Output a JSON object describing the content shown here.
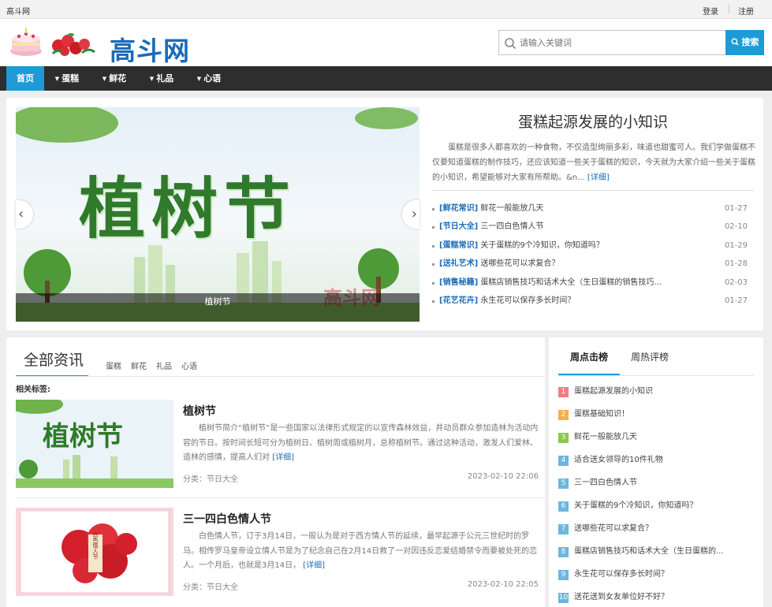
{
  "topbar": {
    "site_name": "高斗网",
    "login": "登录",
    "register": "注册"
  },
  "header": {
    "logo_text": "高斗网",
    "search_placeholder": "请输入关键词",
    "search_button": "搜索"
  },
  "nav": {
    "items": [
      {
        "label": "首页",
        "active": true
      },
      {
        "label": "蛋糕"
      },
      {
        "label": "鲜花"
      },
      {
        "label": "礼品"
      },
      {
        "label": "心语"
      }
    ]
  },
  "slider": {
    "title": "植树节",
    "caption": "植树节",
    "watermark": "高斗网"
  },
  "feature": {
    "title": "蛋糕起源发展的小知识",
    "desc": "蛋糕是很多人都喜欢的一种食物，不仅造型绚丽多彩，味道也甜蜜可人。我们学做蛋糕不仅要知道蛋糕的制作技巧，还应该知道一些关于蛋糕的知识，今天就为大家介绍一些关于蛋糕的小知识，希望能够对大家有所帮助。&n...",
    "more": "[详细]"
  },
  "news": [
    {
      "tag": "[鲜花常识]",
      "title": "鲜花一般能放几天",
      "date": "01-27"
    },
    {
      "tag": "[节日大全]",
      "title": "三一四白色情人节",
      "date": "02-10"
    },
    {
      "tag": "[蛋糕常识]",
      "title": "关于蛋糕的9个冷知识，你知道吗？",
      "date": "01-29"
    },
    {
      "tag": "[送礼艺术]",
      "title": "送哪些花可以求复合？",
      "date": "01-28"
    },
    {
      "tag": "[销售秘籍]",
      "title": "蛋糕店销售技巧和话术大全（生日蛋糕的销售技巧...",
      "date": "02-03"
    },
    {
      "tag": "[花艺花卉]",
      "title": "永生花可以保存多长时间？",
      "date": "01-27"
    }
  ],
  "main": {
    "section_title": "全部资讯",
    "categories": [
      "蛋糕",
      "鲜花",
      "礼品",
      "心语"
    ],
    "related_label": "相关标签:",
    "articles": [
      {
        "title": "植树节",
        "thumb_text": "植树节",
        "desc": "植树节简介“植树节”是一些国家以法律形式规定的以宣传森林效益，并动员群众参加造林为活动内容的节日。按时间长短可分为植树日、植树周或植树月，总称植树节。通过这种活动，激发人们爱林、造林的感情，提高人们对",
        "more": "[详细]",
        "category": "分类：节日大全",
        "time": "2023-02-10 22:06"
      },
      {
        "title": "三一四白色情人节",
        "thumb_text": "白色情人节",
        "desc": "白色情人节，订于3月14日，一般认为是对于西方情人节的延续，最早起源于公元三世纪时的罗马。相传罗马皇帝设立情人节是为了纪念自己在2月14日救了一对因违反恋爱结婚禁令而要被处死的恋人。一个月后，也就是3月14日，",
        "more": "[详细]",
        "category": "分类：节日大全",
        "time": "2023-02-10 22:05"
      }
    ]
  },
  "rank": {
    "tab_active": "周点击榜",
    "tab_other": "周热评榜",
    "items": [
      {
        "num": "1",
        "title": "蛋糕起源发展的小知识",
        "color": "#f08080"
      },
      {
        "num": "2",
        "title": "蛋糕基础知识！",
        "color": "#f3b04a"
      },
      {
        "num": "3",
        "title": "鲜花一般能放几天",
        "color": "#8cc850"
      },
      {
        "num": "4",
        "title": "适合送女领导的10件礼物",
        "color": "#6cb6e0"
      },
      {
        "num": "5",
        "title": "三一四白色情人节",
        "color": "#6cb6e0"
      },
      {
        "num": "6",
        "title": "关于蛋糕的9个冷知识，你知道吗？",
        "color": "#6cb6e0"
      },
      {
        "num": "7",
        "title": "送哪些花可以求复合？",
        "color": "#6cb6e0"
      },
      {
        "num": "8",
        "title": "蛋糕店销售技巧和话术大全（生日蛋糕的...",
        "color": "#6cb6e0"
      },
      {
        "num": "9",
        "title": "永生花可以保存多长时间？",
        "color": "#6cb6e0"
      },
      {
        "num": "10",
        "title": "送花送到女友单位好不好？",
        "color": "#6cb6e0"
      }
    ]
  },
  "colors": {
    "accent": "#1e9bd7",
    "nav_bg": "#2e2e2e",
    "link": "#1a6bb8"
  }
}
